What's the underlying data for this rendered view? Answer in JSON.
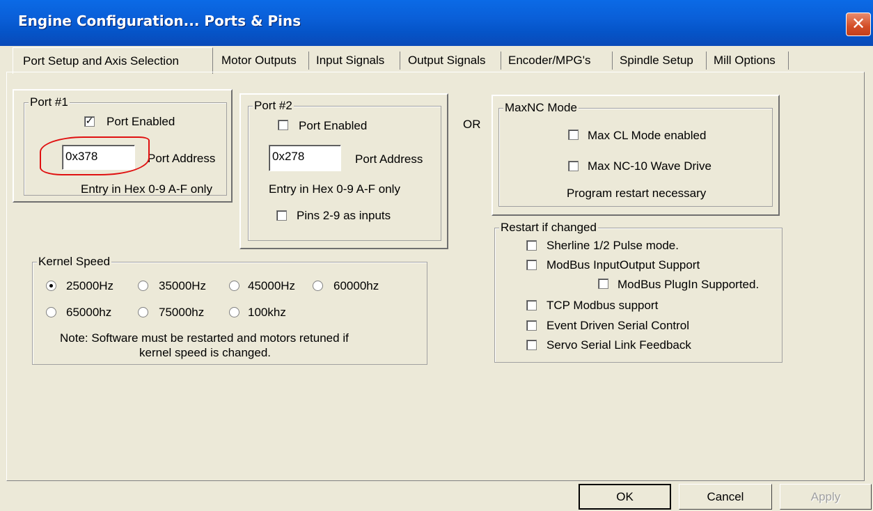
{
  "window": {
    "title": "Engine Configuration... Ports & Pins",
    "close_glyph": "✕"
  },
  "tabs": [
    "Port Setup and Axis Selection",
    "Motor Outputs",
    "Input Signals",
    "Output Signals",
    "Encoder/MPG's",
    "Spindle Setup",
    "Mill Options"
  ],
  "port1": {
    "legend": "Port #1",
    "enabled_label": "Port Enabled",
    "enabled": true,
    "address_value": "0x378",
    "address_label": "Port Address",
    "hint": "Entry in Hex 0-9 A-F only"
  },
  "port2": {
    "legend": "Port #2",
    "enabled_label": "Port Enabled",
    "enabled": false,
    "address_value": "0x278",
    "address_label": "Port Address",
    "hint": "Entry in Hex 0-9 A-F only",
    "pins_label": "Pins 2-9 as inputs",
    "pins_checked": false
  },
  "or_label": "OR",
  "maxnc": {
    "legend": "MaxNC Mode",
    "max_cl_label": "Max CL Mode enabled",
    "max_nc10_label": "Max NC-10 Wave Drive",
    "note": "Program restart necessary"
  },
  "restart": {
    "legend": "Restart if changed",
    "items": [
      "Sherline 1/2 Pulse mode.",
      "ModBus InputOutput Support",
      "ModBus PlugIn Supported.",
      "TCP Modbus support",
      "Event Driven Serial Control",
      "Servo Serial Link Feedback"
    ]
  },
  "kernel": {
    "legend": "Kernel Speed",
    "options": [
      "25000Hz",
      "35000Hz",
      "45000Hz",
      "60000hz",
      "65000hz",
      "75000hz",
      "100khz"
    ],
    "selected": "25000Hz",
    "note_line1": "Note: Software must be restarted and motors retuned if",
    "note_line2": "kernel speed is changed."
  },
  "buttons": {
    "ok": "OK",
    "cancel": "Cancel",
    "apply": "Apply"
  },
  "colors": {
    "title_bar": "#0a5fd8",
    "dialog_bg": "#ece9d8",
    "annotation": "#e01010"
  }
}
